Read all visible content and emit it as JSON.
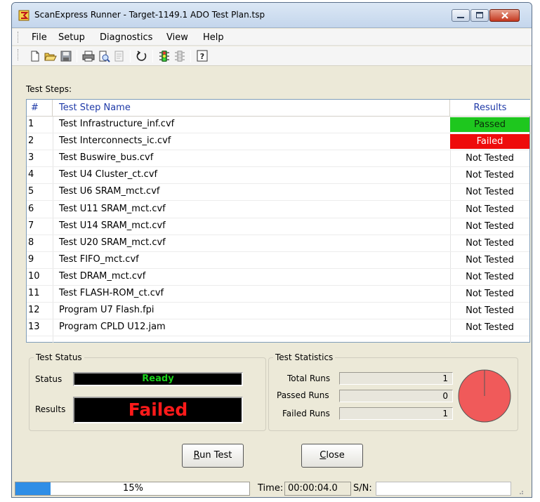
{
  "window": {
    "title": "ScanExpress Runner - Target-1149.1 ADO Test Plan.tsp"
  },
  "menu": [
    "File",
    "Setup",
    "Diagnostics",
    "View",
    "Help"
  ],
  "toolbar_icons": [
    "new-file-icon",
    "open-folder-icon",
    "save-icon",
    "print-icon",
    "print-preview-icon",
    "properties-icon",
    "refresh-icon",
    "traffic-light-icon",
    "traffic-light-disabled-icon",
    "help-icon"
  ],
  "steps": {
    "label": "Test Steps:",
    "columns": [
      "#",
      "Test Step Name",
      "Results"
    ],
    "rows": [
      {
        "num": "1",
        "name": "Test Infrastructure_inf.cvf",
        "result": "Passed"
      },
      {
        "num": "2",
        "name": "Test Interconnects_ic.cvf",
        "result": "Failed"
      },
      {
        "num": "3",
        "name": "Test Buswire_bus.cvf",
        "result": "Not Tested"
      },
      {
        "num": "4",
        "name": "Test U4 Cluster_ct.cvf",
        "result": "Not Tested"
      },
      {
        "num": "5",
        "name": "Test U6 SRAM_mct.cvf",
        "result": "Not Tested"
      },
      {
        "num": "6",
        "name": "Test U11 SRAM_mct.cvf",
        "result": "Not Tested"
      },
      {
        "num": "7",
        "name": "Test U14 SRAM_mct.cvf",
        "result": "Not Tested"
      },
      {
        "num": "8",
        "name": "Test U20 SRAM_mct.cvf",
        "result": "Not Tested"
      },
      {
        "num": "9",
        "name": "Test FIFO_mct.cvf",
        "result": "Not Tested"
      },
      {
        "num": "10",
        "name": "Test DRAM_mct.cvf",
        "result": "Not Tested"
      },
      {
        "num": "11",
        "name": "Test FLASH-ROM_ct.cvf",
        "result": "Not Tested"
      },
      {
        "num": "12",
        "name": "Program U7 Flash.fpi",
        "result": "Not Tested"
      },
      {
        "num": "13",
        "name": "Program CPLD U12.jam",
        "result": "Not Tested"
      }
    ]
  },
  "status": {
    "group_title": "Test Status",
    "status_label": "Status",
    "status_value": "Ready",
    "results_label": "Results",
    "results_value": "Failed"
  },
  "stats": {
    "group_title": "Test Statistics",
    "total_label": "Total Runs",
    "total_value": "1",
    "passed_label": "Passed Runs",
    "passed_value": "0",
    "failed_label": "Failed Runs",
    "failed_value": "1",
    "pie_fail_fraction": 1.0,
    "pie_color": "#f05a5a"
  },
  "buttons": {
    "run_first": "R",
    "run_rest": "un Test",
    "close_first": "C",
    "close_rest": "lose"
  },
  "statusbar": {
    "progress_text": "15%",
    "progress_fraction": 0.15,
    "time_label": "Time:",
    "time_value": "00:00:04.0",
    "sn_label": "S/N:",
    "sn_value": ""
  },
  "colors": {
    "passed": "#1ec71e",
    "failed": "#ee0c0c",
    "progress": "#2f8ee6"
  }
}
